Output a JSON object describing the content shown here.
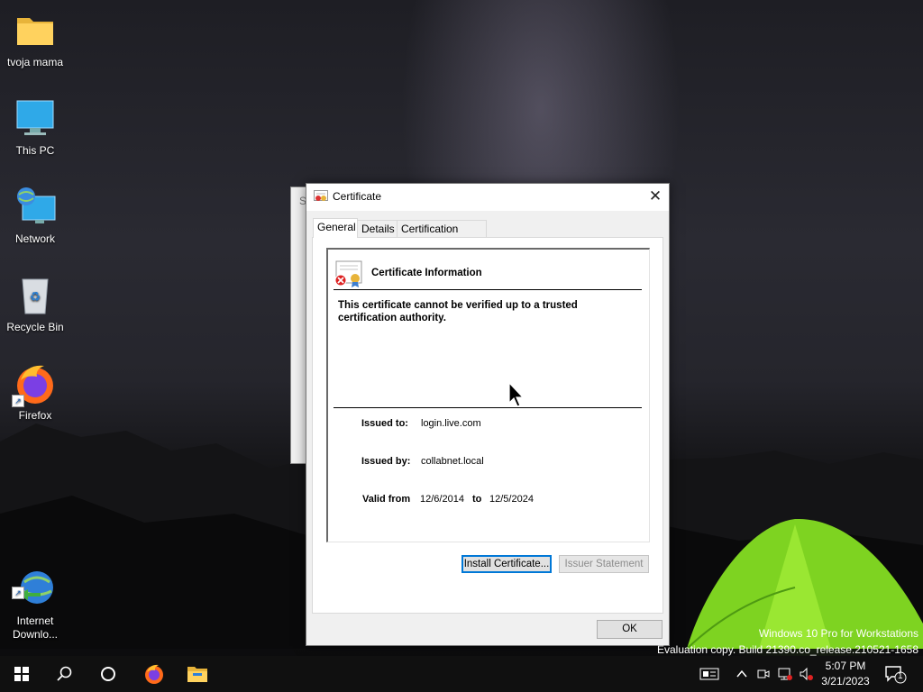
{
  "desktop": {
    "icons": [
      {
        "label": "tvoja mama",
        "icon": "folder-icon"
      },
      {
        "label": "This PC",
        "icon": "computer-icon"
      },
      {
        "label": "Network",
        "icon": "network-icon"
      },
      {
        "label": "Recycle Bin",
        "icon": "recycle-bin-icon"
      },
      {
        "label": "Firefox",
        "icon": "firefox-icon"
      },
      {
        "label": "Internet\nDownlo...",
        "icon": "internet-download-manager-icon"
      }
    ],
    "background_window_letter": "S"
  },
  "dialog": {
    "title": "Certificate",
    "close_glyph": "✕",
    "tabs": [
      "General",
      "Details",
      "Certification Path"
    ],
    "active_tab": "General",
    "info_heading": "Certificate Information",
    "warning": "This certificate cannot be verified up to a trusted certification authority.",
    "issued_to_label": "Issued to:",
    "issued_to_value": "login.live.com",
    "issued_by_label": "Issued by:",
    "issued_by_value": "collabnet.local",
    "valid_from_label": "Valid from",
    "valid_from_value": "12/6/2014",
    "valid_to_label": "to",
    "valid_to_value": "12/5/2024",
    "install_button": "Install Certificate...",
    "issuer_statement_button": "Issuer Statement",
    "ok_button": "OK"
  },
  "watermark": {
    "line1": "Windows 10 Pro for Workstations",
    "line2": "Evaluation copy. Build 21390.co_release.210521-1658"
  },
  "taskbar": {
    "time": "5:07 PM",
    "date": "3/21/2023",
    "notification_count": "1",
    "colors": {
      "accent": "#0078d7",
      "taskbar": "#101010"
    }
  }
}
